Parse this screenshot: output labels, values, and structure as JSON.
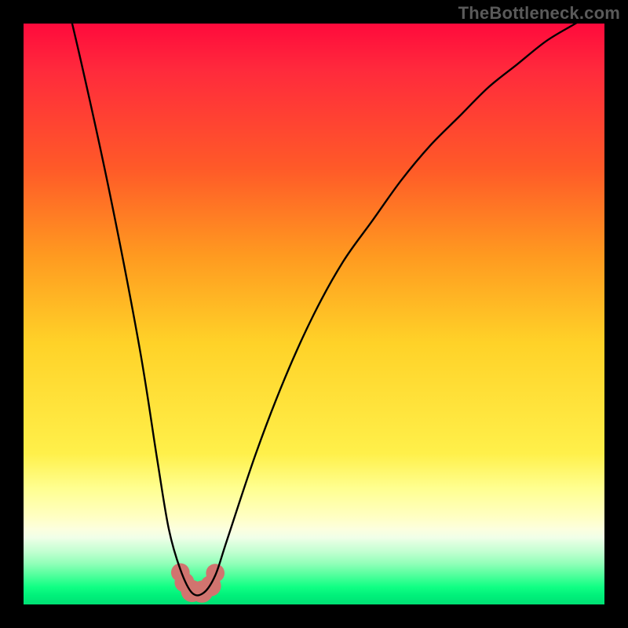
{
  "watermark": "TheBottleneck.com",
  "colors": {
    "background": "#000000",
    "curve_stroke": "#000000",
    "bump_fill": "#d1746f",
    "gradient_top": "#ff0a3c",
    "gradient_bottom": "#00e074"
  },
  "chart_data": {
    "type": "line",
    "title": "",
    "xlabel": "",
    "ylabel": "",
    "xlim": [
      0,
      100
    ],
    "ylim": [
      0,
      100
    ],
    "series": [
      {
        "name": "bottleneck-curve",
        "x": [
          0,
          5,
          10,
          15,
          20,
          23,
          25,
          27,
          29,
          31,
          33,
          35,
          40,
          45,
          50,
          55,
          60,
          65,
          70,
          75,
          80,
          85,
          90,
          95,
          100
        ],
        "values": [
          134,
          114,
          93,
          70,
          44,
          25,
          13,
          6,
          2,
          2,
          5,
          11,
          26,
          39,
          50,
          59,
          66,
          73,
          79,
          84,
          89,
          93,
          97,
          100,
          103
        ]
      }
    ],
    "optimal_region": {
      "x_start": 26,
      "x_end": 34,
      "y": 2
    },
    "bumps": [
      {
        "cx": 27.0,
        "cy": 5.5,
        "r": 1.6
      },
      {
        "cx": 27.7,
        "cy": 3.8,
        "r": 1.7
      },
      {
        "cx": 29.0,
        "cy": 2.3,
        "r": 1.9
      },
      {
        "cx": 30.7,
        "cy": 2.2,
        "r": 1.9
      },
      {
        "cx": 32.2,
        "cy": 3.2,
        "r": 1.8
      },
      {
        "cx": 33.0,
        "cy": 5.4,
        "r": 1.6
      }
    ]
  }
}
